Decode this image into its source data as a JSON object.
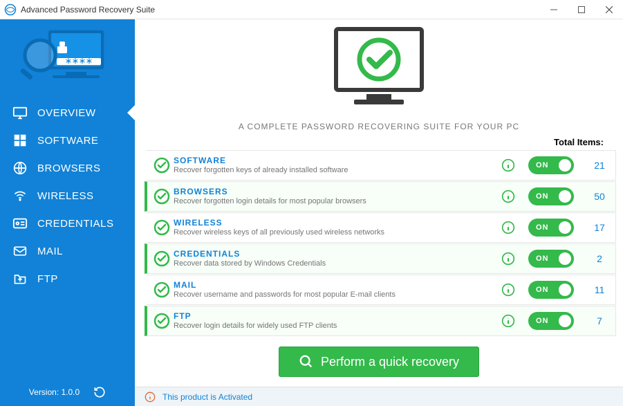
{
  "window": {
    "title": "Advanced Password Recovery Suite"
  },
  "sidebar": {
    "items": [
      {
        "label": "OVERVIEW"
      },
      {
        "label": "SOFTWARE"
      },
      {
        "label": "BROWSERS"
      },
      {
        "label": "WIRELESS"
      },
      {
        "label": "CREDENTIALS"
      },
      {
        "label": "MAIL"
      },
      {
        "label": "FTP"
      }
    ],
    "version_label": "Version: 1.0.0"
  },
  "main": {
    "tagline": "A COMPLETE PASSWORD RECOVERING SUITE FOR YOUR PC",
    "total_label": "Total Items:",
    "action_label": "Perform a quick recovery",
    "toggle_label": "ON"
  },
  "categories": [
    {
      "title": "SOFTWARE",
      "desc": "Recover forgotten keys of already installed software",
      "count": "21"
    },
    {
      "title": "BROWSERS",
      "desc": "Recover forgotten login details for most popular browsers",
      "count": "50"
    },
    {
      "title": "WIRELESS",
      "desc": "Recover wireless keys of all previously used wireless networks",
      "count": "17"
    },
    {
      "title": "CREDENTIALS",
      "desc": "Recover data stored by Windows Credentials",
      "count": "2"
    },
    {
      "title": "MAIL",
      "desc": "Recover username and passwords for most popular E-mail clients",
      "count": "11"
    },
    {
      "title": "FTP",
      "desc": "Recover login details for widely used FTP clients",
      "count": "7"
    }
  ],
  "status": {
    "text": "This product is Activated"
  }
}
